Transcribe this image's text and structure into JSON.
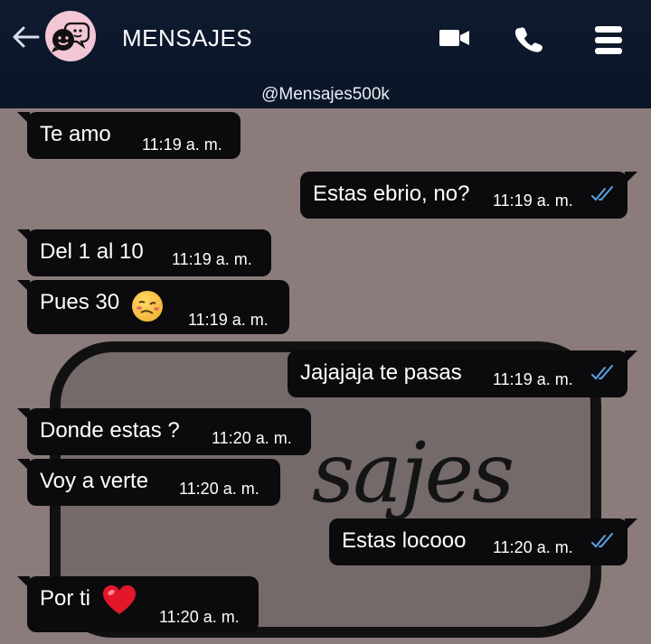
{
  "header": {
    "title": "MENSAJES",
    "handle": "@Mensajes500k",
    "icons": [
      "back-arrow-icon",
      "video-call-icon",
      "phone-icon",
      "menu-icon"
    ]
  },
  "messages": [
    {
      "dir": "in",
      "text": "Te amo",
      "time": "11:19 a. m."
    },
    {
      "dir": "out",
      "text": "Estas ebrio, no?",
      "time": "11:19 a. m.",
      "status": "read"
    },
    {
      "dir": "in",
      "text": "Del 1 al 10",
      "time": "11:19 a. m."
    },
    {
      "dir": "in",
      "text": "Pues 30",
      "time": "11:19 a. m.",
      "emoji": "woozy-face"
    },
    {
      "dir": "out",
      "text": "Jajajaja te pasas",
      "time": "11:19 a. m.",
      "status": "read"
    },
    {
      "dir": "in",
      "text": "Donde estas ?",
      "time": "11:20 a. m."
    },
    {
      "dir": "in",
      "text": "Voy a verte",
      "time": "11:20 a. m."
    },
    {
      "dir": "out",
      "text": "Estas locooo",
      "time": "11:20 a. m.",
      "status": "read"
    },
    {
      "dir": "in",
      "text": "Por ti",
      "time": "11:20 a. m.",
      "emoji": "red-heart"
    }
  ],
  "watermark": {
    "text": "sajes"
  },
  "colors": {
    "header_bg": "#0b1528",
    "chat_bg": "#8b7b7b",
    "bubble_bg": "#0b0b0d",
    "read_ticks": "#5aa2e6",
    "avatar_bg": "#f3c6d6"
  }
}
